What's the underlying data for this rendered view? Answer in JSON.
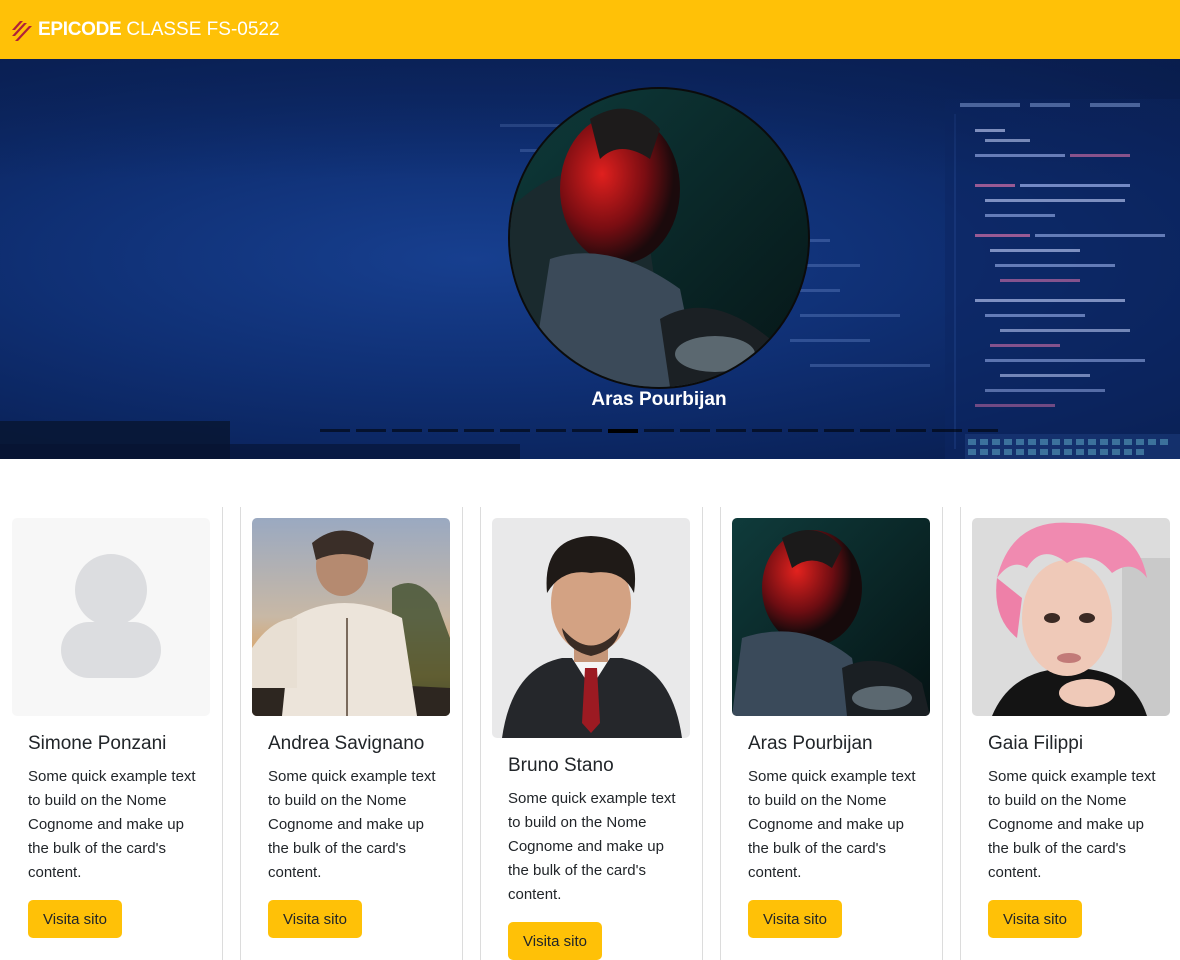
{
  "navbar": {
    "brand_name": "EPICODE",
    "class_label": "CLASSE FS-0522",
    "colors": {
      "background": "#ffc107",
      "text": "#ffffff",
      "logo": "#b0213a"
    }
  },
  "hero": {
    "caption": "Aras Pourbijan",
    "indicator_count": 19,
    "active_indicator": 8,
    "background_color": "#0f2f73"
  },
  "cards": [
    {
      "name": "Simone Ponzani",
      "text": "Some quick example text to build on the Nome Cognome and make up the bulk of the card's content.",
      "button": "Visita sito",
      "image": "avatar-placeholder"
    },
    {
      "name": "Andrea Savignano",
      "text": "Some quick example text to build on the Nome Cognome and make up the bulk of the card's content.",
      "button": "Visita sito",
      "image": "profile-photo"
    },
    {
      "name": "Bruno Stano",
      "text": "Some quick example text to build on the Nome Cognome and make up the bulk of the card's content.",
      "button": "Visita sito",
      "image": "profile-photo"
    },
    {
      "name": "Aras Pourbijan",
      "text": "Some quick example text to build on the Nome Cognome and make up the bulk of the card's content.",
      "button": "Visita sito",
      "image": "profile-photo"
    },
    {
      "name": "Gaia Filippi",
      "text": "Some quick example text to build on the Nome Cognome and make up the bulk of the card's content.",
      "button": "Visita sito",
      "image": "profile-photo"
    }
  ],
  "accent_color": "#ffc107"
}
